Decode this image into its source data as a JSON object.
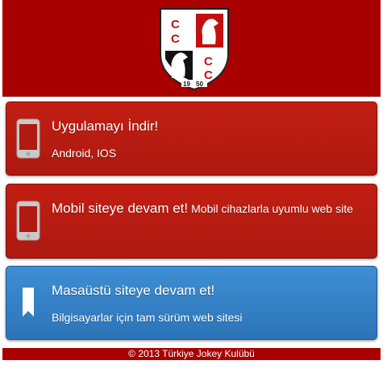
{
  "brand": {
    "logo_letters": "CC CC",
    "logo_year_left": "19",
    "logo_year_right": "50",
    "colors": {
      "primary_red": "#a80000",
      "blue": "#2c74b7"
    }
  },
  "cards": [
    {
      "title": "Uygulamayı İndir!",
      "subtitle": "Android, IOS",
      "icon": "phone-icon"
    },
    {
      "title": "Mobil siteye devam et!",
      "subtitle": "Mobil cihazlarla uyumlu web site",
      "icon": "phone-icon"
    },
    {
      "title": "Masaüstü siteye devam et!",
      "subtitle": "Bilgisayarlar için tam sürüm web sitesi",
      "icon": "bookmark-icon"
    }
  ],
  "footer": {
    "text": "© 2013 Türkiye Jokey Kulübü"
  }
}
